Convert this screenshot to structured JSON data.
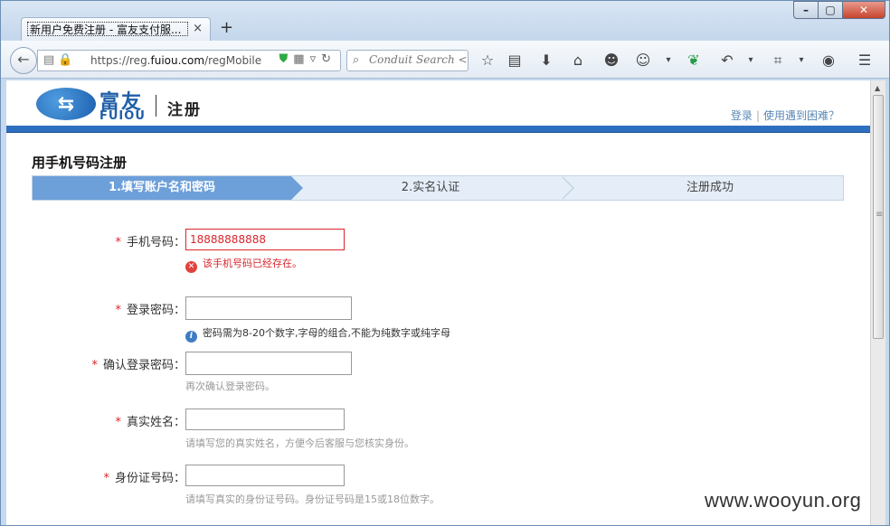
{
  "browser": {
    "tab_title": "新用户免费注册 - 富友支付服...",
    "tab_close": "×",
    "new_tab": "+",
    "url_prefix": "https://reg.",
    "url_domain": "fuiou.com",
    "url_path": "/regMobile",
    "search_placeholder": "Conduit Search <Ct",
    "window_controls": {
      "minimize": "–",
      "maximize": "▢",
      "close": "✕"
    }
  },
  "header": {
    "logo_cn": "富友",
    "logo_en": "FUIOU",
    "title": "注册",
    "login_link": "登录",
    "link_sep": "|",
    "help_link": "使用遇到困难？"
  },
  "page": {
    "heading": "用手机号码注册",
    "steps": [
      "1.填写账户名和密码",
      "2.实名认证",
      "注册成功"
    ],
    "required_mark": "*"
  },
  "form": {
    "phone": {
      "label": "手机号码：",
      "value": "18888888888",
      "error": "该手机号码已经存在。"
    },
    "password": {
      "label": "登录密码：",
      "value": "",
      "info": "密码需为8-20个数字,字母的组合,不能为纯数字或纯字母"
    },
    "confirm_password": {
      "label": "确认登录密码：",
      "value": "",
      "hint": "再次确认登录密码。"
    },
    "real_name": {
      "label": "真实姓名：",
      "value": "",
      "hint": "请填写您的真实姓名，方便今后客服与您核实身份。"
    },
    "id_number": {
      "label": "身份证号码：",
      "value": "",
      "hint": "请填写真实的身份证号码。身份证号码是15或18位数字。"
    }
  },
  "watermark": "www.wooyun.org",
  "colors": {
    "brand_blue": "#2f6fc0",
    "step_active": "#6d9fd9",
    "error_red": "#d9262c",
    "link_blue": "#5b87b5"
  }
}
